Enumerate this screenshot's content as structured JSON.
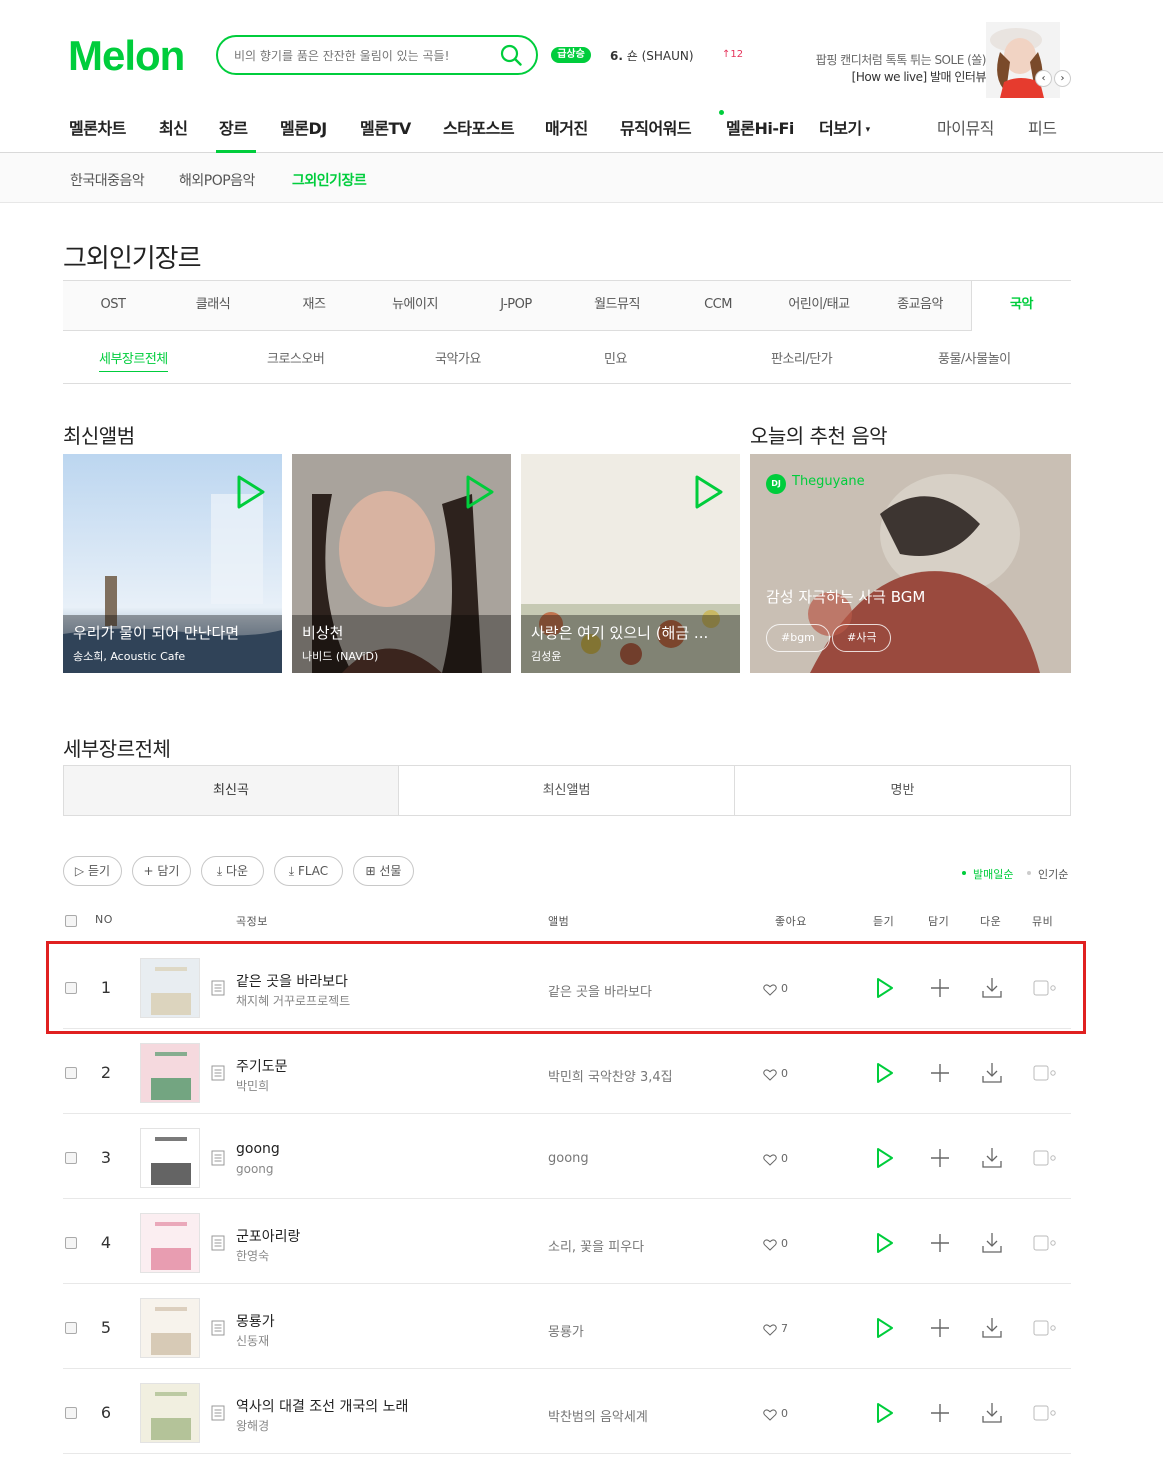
{
  "header": {
    "logo": "Melon",
    "search_placeholder": "비의 향기를 품은 잔잔한 울림이 있는 곡들!",
    "rising_badge": "급상승",
    "rising_rank": "6.",
    "rising_song": "숀 (SHAUN)",
    "rising_count": "12",
    "promo_line1": "팝핑 캔디처럼 톡톡 튀는 SOLE (쏠)",
    "promo_line2": "[How we live] 발매 인터뷰",
    "promo_prev": "‹",
    "promo_next": "›"
  },
  "gnb": [
    "멜론차트",
    "최신",
    "장르",
    "멜론DJ",
    "멜론TV",
    "스타포스트",
    "매거진",
    "뮤직어워드",
    "멜론Hi-Fi",
    "더보기"
  ],
  "gnb_right": [
    "마이뮤직",
    "피드"
  ],
  "subnav": [
    "한국대중음악",
    "해외POP음악",
    "그외인기장르"
  ],
  "page_title": "그외인기장르",
  "genre_tabs": [
    "OST",
    "클래식",
    "재즈",
    "뉴에이지",
    "J-POP",
    "월드뮤직",
    "CCM",
    "어린이/태교",
    "종교음악",
    "국악"
  ],
  "sub_tabs": [
    "세부장르전체",
    "크로스오버",
    "국악가요",
    "민요",
    "판소리/단가",
    "풍물/사물놀이"
  ],
  "latest_albums": {
    "title": "최신앨범",
    "items": [
      {
        "title": "우리가 물이 되어 만난다면",
        "artist": "송소희, Acoustic Cafe"
      },
      {
        "title": "비상천",
        "artist": "나비드 (NAViD)"
      },
      {
        "title": "사랑은 여기 있으니 (해금 ...",
        "artist": "김성윤"
      }
    ]
  },
  "recommend": {
    "title": "오늘의 추천 음악",
    "dj_badge": "DJ",
    "dj_name": "Theguyane",
    "playlist_title": "감성 자극하는 사극 BGM",
    "tags": [
      "#bgm",
      "#사극"
    ]
  },
  "section_title": "세부장르전체",
  "content_tabs": [
    "최신곡",
    "최신앨범",
    "명반"
  ],
  "action_buttons": [
    "듣기",
    "담기",
    "다운",
    "FLAC",
    "선물"
  ],
  "sort": [
    "발매일순",
    "인기순"
  ],
  "table_headers": {
    "no": "NO",
    "song": "곡정보",
    "album": "앨범",
    "like": "좋아요",
    "play": "듣기",
    "add": "담기",
    "down": "다운",
    "mv": "뮤비"
  },
  "songs": [
    {
      "no": "1",
      "title": "같은 곳을 바라보다",
      "artist": "채지혜 거꾸로프로젝트",
      "album": "같은 곳을 바라보다",
      "likes": "0"
    },
    {
      "no": "2",
      "title": "주기도문",
      "artist": "박민희",
      "album": "박민희 국악찬양 3,4집",
      "likes": "0"
    },
    {
      "no": "3",
      "title": "goong",
      "artist": "goong",
      "album": "goong",
      "likes": "0"
    },
    {
      "no": "4",
      "title": "군포아리랑",
      "artist": "한영숙",
      "album": "소리, 꽃을 피우다",
      "likes": "0"
    },
    {
      "no": "5",
      "title": "몽룡가",
      "artist": "신동재",
      "album": "몽룡가",
      "likes": "7"
    },
    {
      "no": "6",
      "title": "역사의 대결 조선 개국의 노래",
      "artist": "왕해경",
      "album": "박찬범의 음악세계",
      "likes": "0"
    }
  ],
  "colors": {
    "accent": "#00cd3c",
    "highlight": "#e02020",
    "rising": "#e5335b"
  }
}
